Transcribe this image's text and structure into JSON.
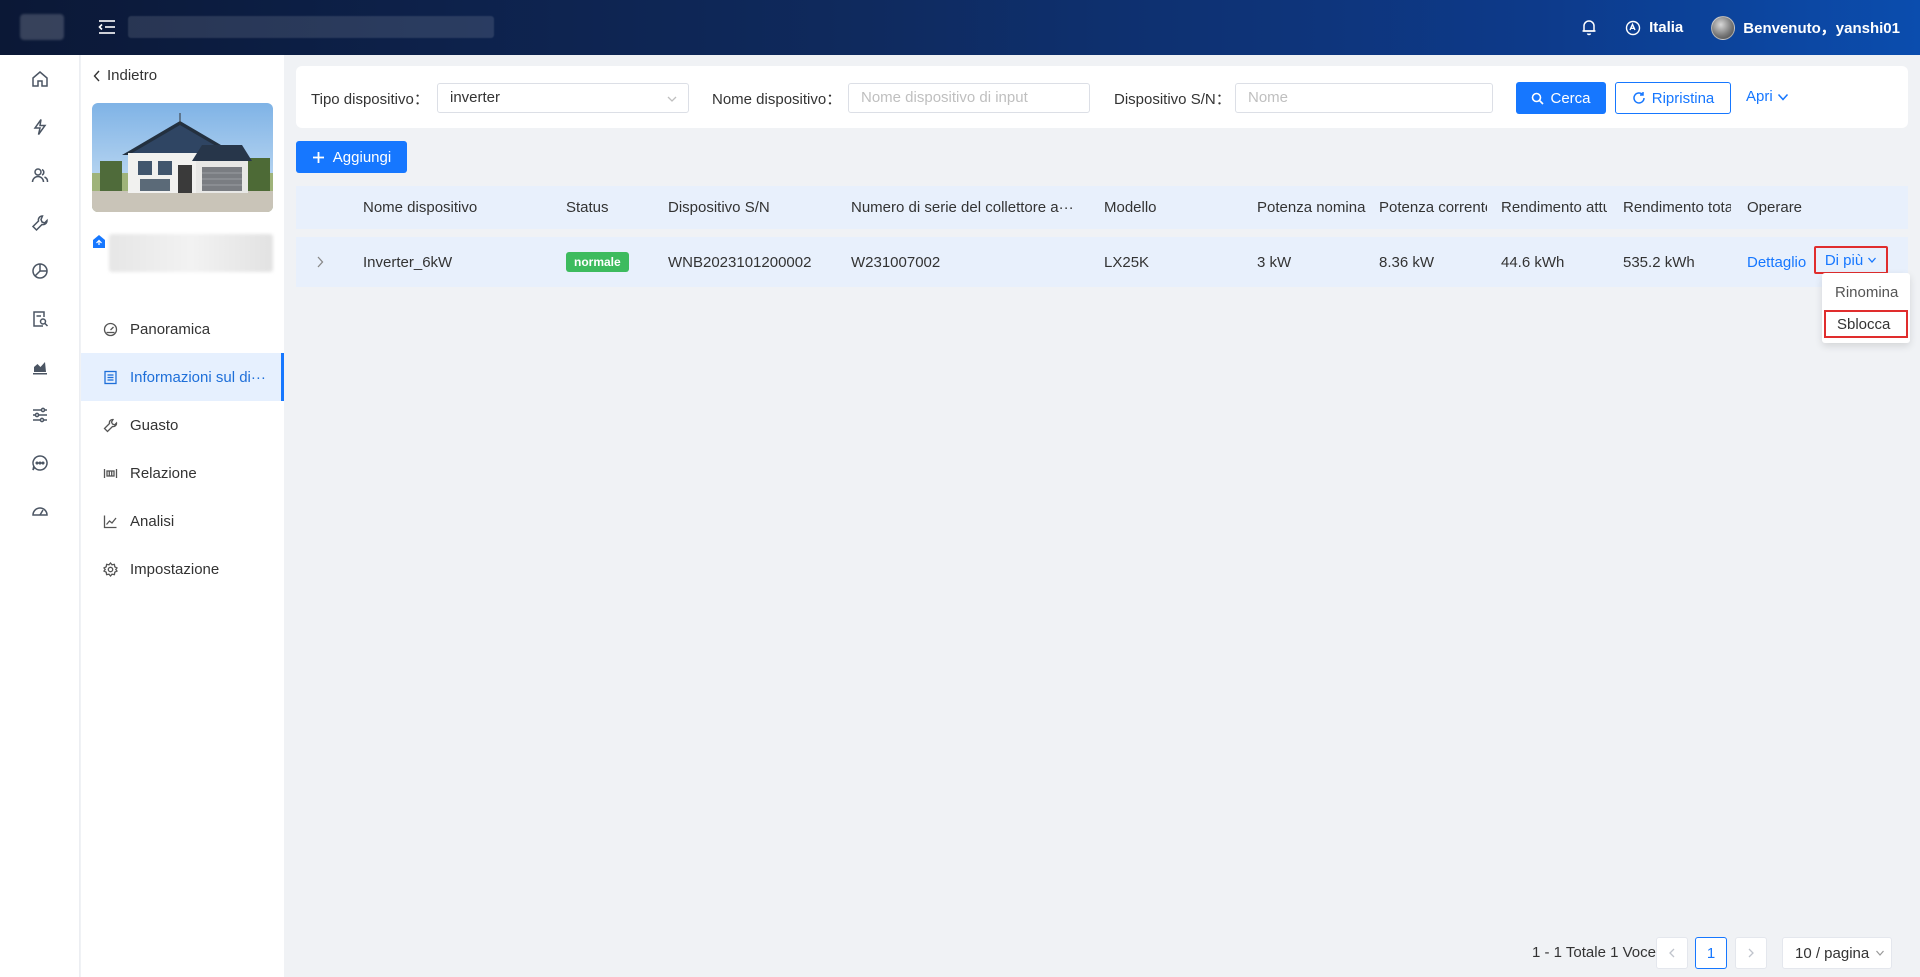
{
  "header": {
    "language": "Italia",
    "welcome": "Benvenuto，yanshi01"
  },
  "rail": {
    "icons": [
      "home-icon",
      "lightning-icon",
      "users-icon",
      "wrench-icon",
      "pie-chart-icon",
      "report-search-icon",
      "bar-chart-icon",
      "sliders-icon",
      "chat-icon",
      "dashboard-gauge-icon"
    ]
  },
  "sidebar": {
    "back_label": "Indietro",
    "items": [
      {
        "label": "Panoramica",
        "icon": "gauge-icon"
      },
      {
        "label": "Informazioni sul di···",
        "icon": "list-icon",
        "active": true
      },
      {
        "label": "Guasto",
        "icon": "wrench-icon"
      },
      {
        "label": "Relazione",
        "icon": "relation-icon"
      },
      {
        "label": "Analisi",
        "icon": "line-chart-icon"
      },
      {
        "label": "Impostazione",
        "icon": "gear-icon"
      }
    ]
  },
  "filters": {
    "type_label": "Tipo dispositivo：",
    "type_value": "inverter",
    "name_label": "Nome dispositivo：",
    "name_placeholder": "Nome dispositivo di input",
    "sn_label": "Dispositivo S/N：",
    "sn_placeholder": "Nome",
    "search_label": "Cerca",
    "reset_label": "Ripristina",
    "expand_label": "Apri"
  },
  "toolbar": {
    "add_label": "Aggiungi"
  },
  "table": {
    "headers": {
      "name": "Nome dispositivo",
      "status": "Status",
      "sn": "Dispositivo S/N",
      "collector": "Numero di serie del collettore a···",
      "model": "Modello",
      "rated_power": "Potenza nomina",
      "current_power": "Potenza corrente",
      "current_yield": "Rendimento attu",
      "total_yield": "Rendimento tota",
      "operate": "Operare"
    },
    "rows": [
      {
        "name": "Inverter_6kW",
        "status": "normale",
        "sn": "WNB2023101200002",
        "collector": "W231007002",
        "model": "LX25K",
        "rated_power": "3 kW",
        "current_power": "8.36 kW",
        "current_yield": "44.6 kWh",
        "total_yield": "535.2 kWh",
        "detail_label": "Dettaglio",
        "more_label": "Di più"
      }
    ]
  },
  "dropdown": {
    "rename": "Rinomina",
    "unlock": "Sblocca"
  },
  "pagination": {
    "summary": "1 - 1 Totale 1 Voce",
    "current_page": "1",
    "page_size": "10 / pagina"
  },
  "colors": {
    "primary": "#1677ff",
    "status_normal": "#3dbb5e",
    "highlight_box": "#e02d2d"
  }
}
